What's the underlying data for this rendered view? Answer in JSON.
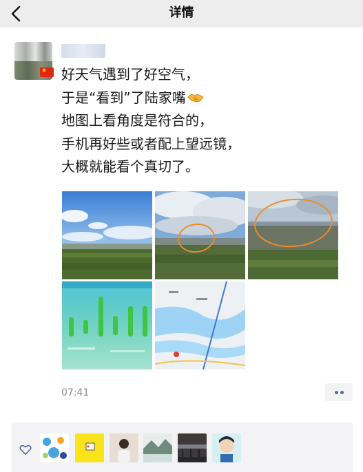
{
  "header": {
    "title": "详情"
  },
  "post": {
    "lines": [
      "好天气遇到了好空气，",
      "于是“看到”了陆家嘴",
      "地图上看角度是符合的，",
      "手机再好些或者配上望远镜，",
      "大概就能看个真切了。"
    ],
    "time": "07:41"
  },
  "images": [
    {
      "name": "photo-landscape-sky"
    },
    {
      "name": "photo-clouds-circled"
    },
    {
      "name": "photo-skyline-circled"
    },
    {
      "name": "photo-air-quality-app"
    },
    {
      "name": "photo-map"
    }
  ],
  "icons": {
    "back": "chevron-left-icon",
    "more": "more-dots-icon",
    "like": "heart-outline-icon",
    "handshake": "handshake-emoji"
  },
  "colors": {
    "link": "#576b95",
    "topbar": "#ededed",
    "panel": "#f3f3f5"
  }
}
